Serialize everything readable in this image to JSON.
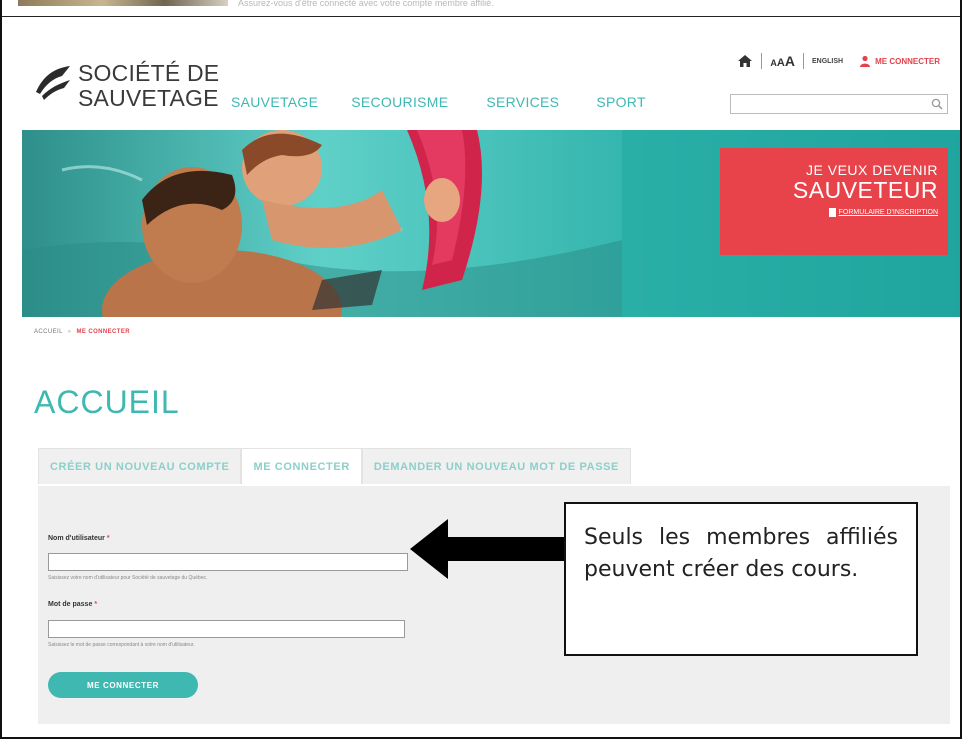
{
  "top_strip": {
    "faint_text": "Assurez-vous d'être connecté avec votre compte membre affilié."
  },
  "logo": {
    "line1": "SOCIÉTÉ DE",
    "line2": "SAUVETAGE"
  },
  "nav": {
    "items": [
      {
        "label": "SAUVETAGE"
      },
      {
        "label": "SECOURISME"
      },
      {
        "label": "SERVICES"
      },
      {
        "label": "SPORT"
      }
    ]
  },
  "utility": {
    "aaa": {
      "a1": "A",
      "a2": "A",
      "a3": "A"
    },
    "english": "ENGLISH",
    "connect": "ME CONNECTER"
  },
  "search": {
    "placeholder": "",
    "value": ""
  },
  "cta": {
    "line1": "JE VEUX DEVENIR",
    "line2": "SAUVETEUR",
    "link": "FORMULAIRE D'INSCRIPTION"
  },
  "breadcrumb": {
    "home": "ACCUEIL",
    "separator": "»",
    "current": "ME CONNECTER"
  },
  "page_title": "ACCUEIL",
  "tabs": [
    {
      "label": "CRÉER UN NOUVEAU COMPTE",
      "active": false
    },
    {
      "label": "ME CONNECTER",
      "active": true
    },
    {
      "label": "DEMANDER UN NOUVEAU MOT DE PASSE",
      "active": false
    }
  ],
  "form": {
    "username_label": "Nom d'utilisateur",
    "username_value": "",
    "username_help": "Saisissez votre nom d'utilisateur pour Société de sauvetage du Québec.",
    "password_label": "Mot de passe",
    "password_value": "",
    "password_help": "Saisissez le mot de passe correspondant à votre nom d'utilisateur.",
    "required_mark": "*",
    "submit_label": "ME CONNECTER"
  },
  "callout": {
    "text": "Seuls les membres affiliés peuvent créer des cours."
  },
  "colors": {
    "accent": "#3fb8b2",
    "cta": "#e8434a",
    "alert": "#e2424c",
    "banner": "#2bb0a8"
  }
}
